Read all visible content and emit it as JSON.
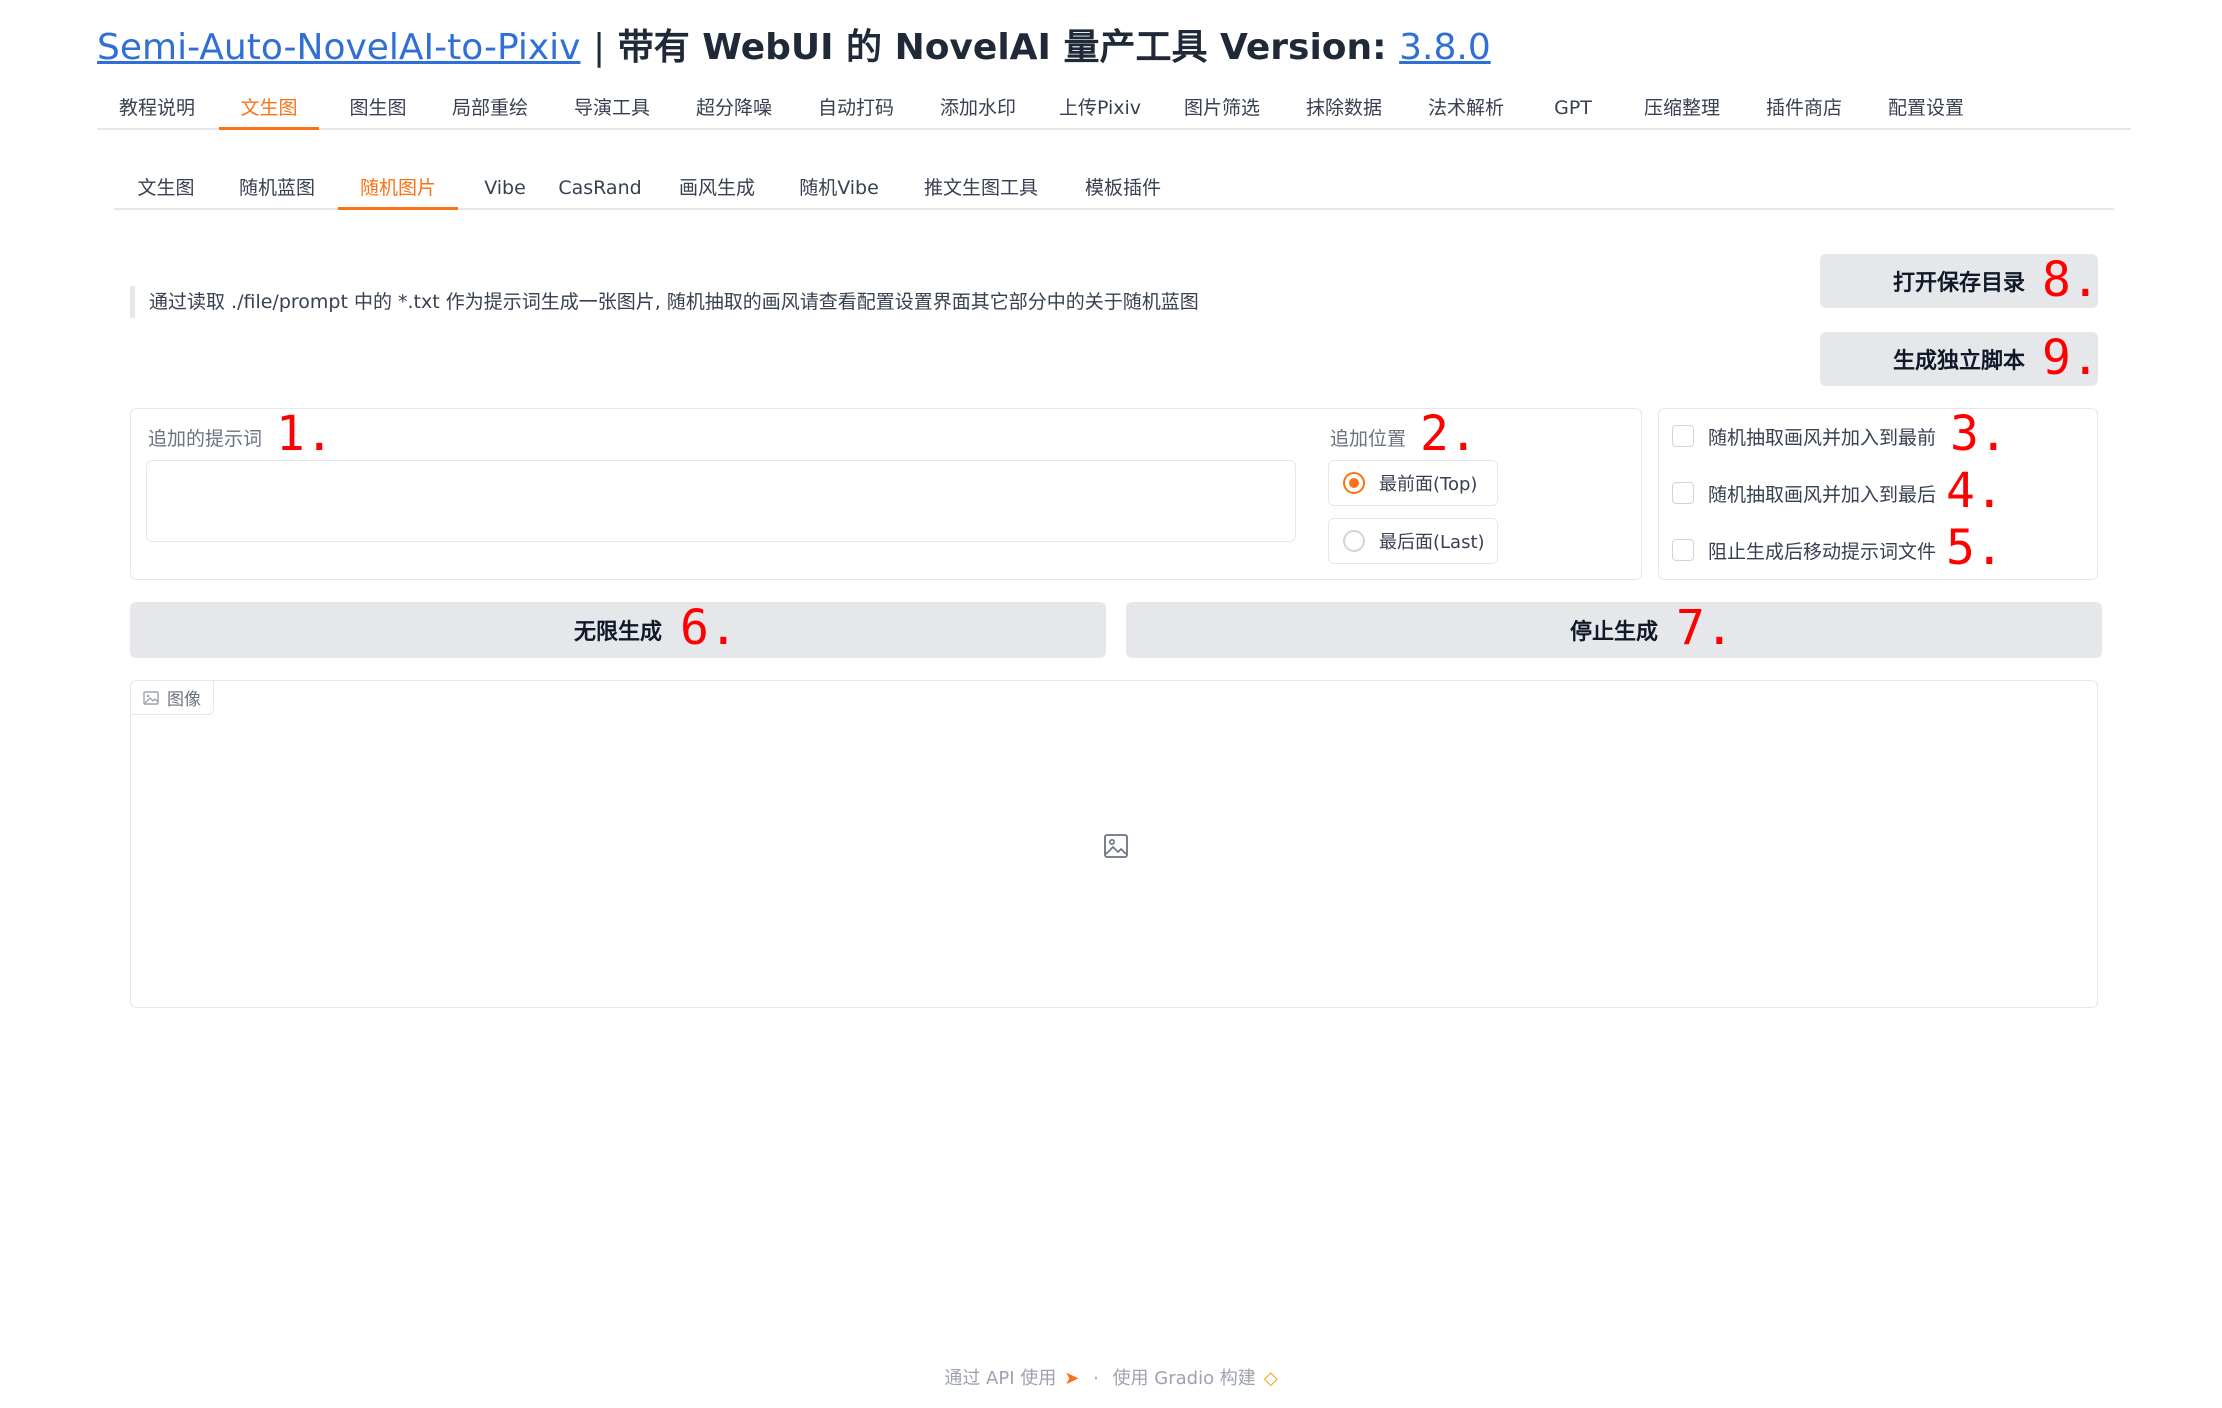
{
  "header": {
    "link_text": "Semi-Auto-NovelAI-to-Pixiv",
    "separator": "|",
    "title_middle": "带有 WebUI 的 NovelAI 量产工具 Version:",
    "version": "3.8.0"
  },
  "main_tabs": [
    "教程说明",
    "文生图",
    "图生图",
    "局部重绘",
    "导演工具",
    "超分降噪",
    "自动打码",
    "添加水印",
    "上传Pixiv",
    "图片筛选",
    "抹除数据",
    "法术解析",
    "GPT",
    "压缩整理",
    "插件商店",
    "配置设置"
  ],
  "main_tabs_active": "文生图",
  "sub_tabs": [
    "文生图",
    "随机蓝图",
    "随机图片",
    "Vibe",
    "CasRand",
    "画风生成",
    "随机Vibe",
    "推文生图工具",
    "模板插件"
  ],
  "sub_tabs_active": "随机图片",
  "description": "通过读取 ./file/prompt 中的 *.txt 作为提示词生成一张图片, 随机抽取的画风请查看配置设置界面其它部分中的关于随机蓝图",
  "buttons": {
    "open_save_dir": "打开保存目录",
    "gen_script": "生成独立脚本",
    "infinite_gen": "无限生成",
    "stop_gen": "停止生成"
  },
  "prompt_input": {
    "label": "追加的提示词",
    "value": "",
    "placeholder": ""
  },
  "position": {
    "label": "追加位置",
    "options": [
      "最前面(Top)",
      "最后面(Last)"
    ],
    "selected": "最前面(Top)"
  },
  "checkboxes": [
    "随机抽取画风并加入到最前",
    "随机抽取画风并加入到最后",
    "阻止生成后移动提示词文件"
  ],
  "image_output": {
    "label": "图像",
    "icon": "image-icon"
  },
  "footer": {
    "api_text": "通过 API 使用",
    "dot": "·",
    "built_text": "使用 Gradio 构建"
  },
  "annotations": {
    "a1": "1.",
    "a2": "2.",
    "a3": "3.",
    "a4": "4.",
    "a5": "5.",
    "a6": "6.",
    "a7": "7.",
    "a8": "8.",
    "a9": "9."
  },
  "colors": {
    "accent": "#f97316",
    "link": "#2f6fd6",
    "button_bg": "#e5e7eb",
    "annotation": "#ff0000"
  }
}
